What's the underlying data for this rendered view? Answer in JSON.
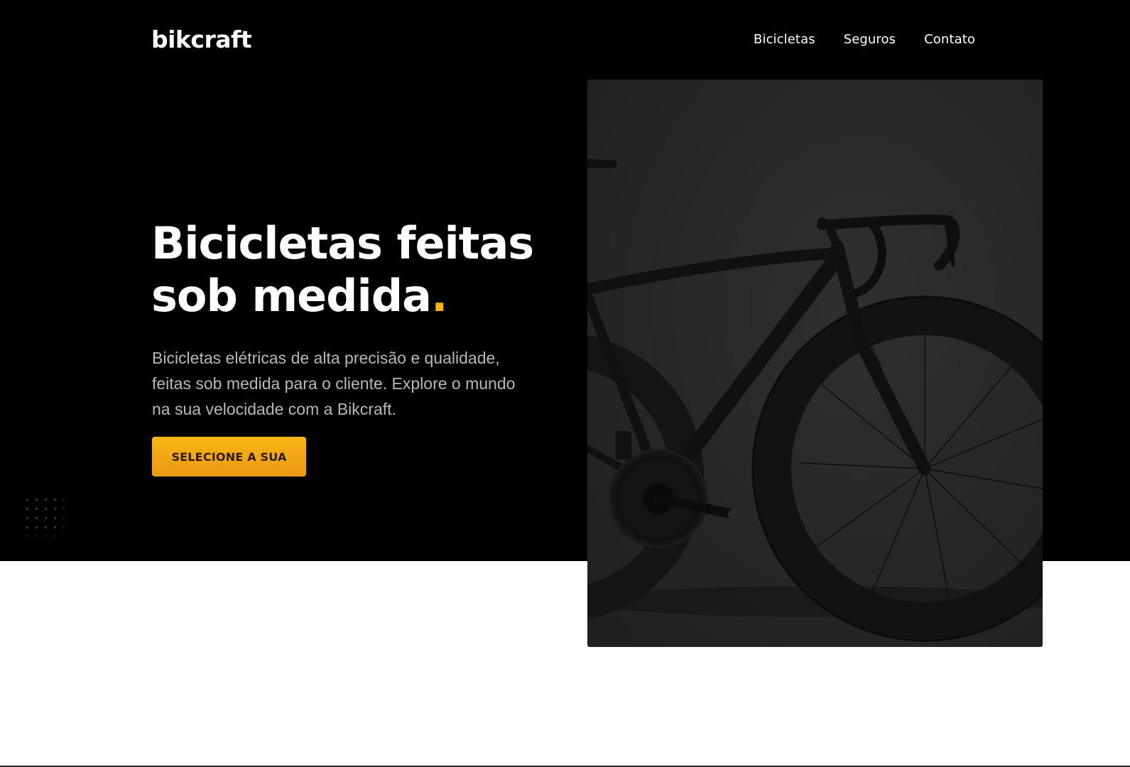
{
  "header": {
    "logo": "bikcraft",
    "nav": [
      {
        "label": "Bicicletas"
      },
      {
        "label": "Seguros"
      },
      {
        "label": "Contato"
      }
    ]
  },
  "hero": {
    "headline_line1": "Bicicletas feitas",
    "headline_line2": "sob medida",
    "headline_dot": ".",
    "description": "Bicicletas elétricas de alta precisão e qualidade, feitas sob medida para o cliente. Explore o mundo na sua velocidade com a Bikcraft.",
    "cta_label": "SELECIONE A SUA",
    "image_alt": "road-bike-photo"
  },
  "colors": {
    "accent": "#fbb110",
    "hero_background": "#000000",
    "page_background": "#ffffff"
  }
}
